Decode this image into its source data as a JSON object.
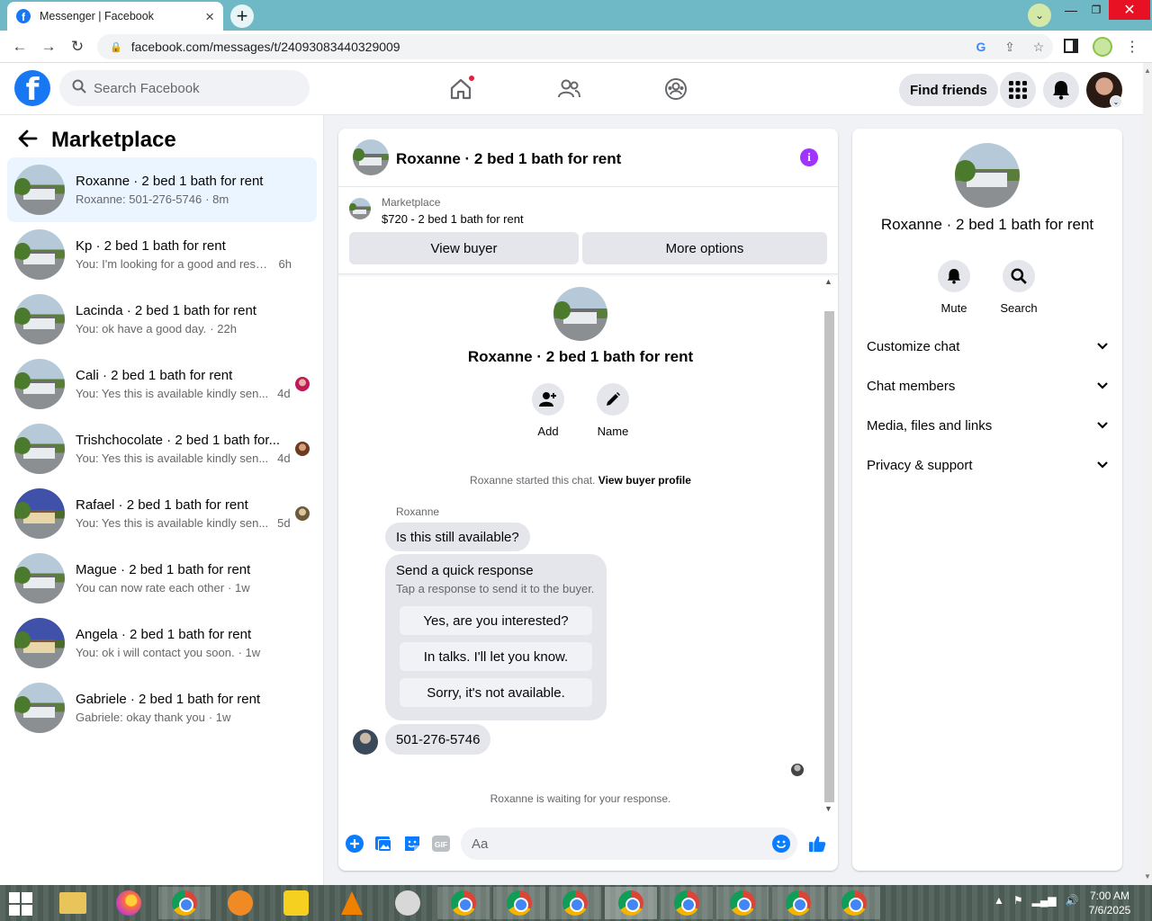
{
  "browser": {
    "tab_title": "Messenger | Facebook",
    "url": "facebook.com/messages/t/24093083440329009"
  },
  "header": {
    "search_placeholder": "Search Facebook",
    "find_friends": "Find friends"
  },
  "sidebar": {
    "title": "Marketplace",
    "conversations": [
      {
        "name": "Roxanne · 2 bed 1 bath for rent",
        "message": "Roxanne: 501-276-5746",
        "time": "· 8m",
        "active": true
      },
      {
        "name": "Kp · 2 bed 1 bath for rent",
        "message": "You: I'm looking for a good and respo...",
        "time": "6h"
      },
      {
        "name": "Lacinda · 2 bed 1 bath for rent",
        "message": "You: ok have a good day.",
        "time": "· 22h"
      },
      {
        "name": "Cali · 2 bed 1 bath for rent",
        "message": "You: Yes this is available kindly sen...",
        "time": "4d"
      },
      {
        "name": "Trishchocolate · 2 bed 1 bath for...",
        "message": "You: Yes this is available kindly sen...",
        "time": "4d"
      },
      {
        "name": "Rafael · 2 bed 1 bath for rent",
        "message": "You: Yes this is available kindly sen...",
        "time": "5d"
      },
      {
        "name": "Mague · 2 bed 1 bath for rent",
        "message": "You can now rate each other",
        "time": "· 1w"
      },
      {
        "name": "Angela · 2 bed 1 bath for rent",
        "message": "You: ok i will contact you soon.",
        "time": "· 1w"
      },
      {
        "name": "Gabriele · 2 bed 1 bath for rent",
        "message": "Gabriele: okay thank you",
        "time": "· 1w"
      }
    ]
  },
  "chat": {
    "title": "Roxanne · 2 bed 1 bath for rent",
    "listing_category": "Marketplace",
    "listing_price": "$720 - 2 bed 1 bath for rent",
    "view_buyer": "View buyer",
    "more_options": "More options",
    "intro_title": "Roxanne · 2 bed 1 bath for rent",
    "add_label": "Add",
    "name_label": "Name",
    "started_text": "Roxanne started this chat.",
    "view_buyer_profile": "View buyer profile",
    "sender": "Roxanne",
    "message1": "Is this still available?",
    "quick_title": "Send a quick response",
    "quick_sub": "Tap a response to send it to the buyer.",
    "quick_replies": [
      "Yes, are you interested?",
      "In talks. I'll let you know.",
      "Sorry, it's not available."
    ],
    "message2": "501-276-5746",
    "waiting": "Roxanne is waiting for your response.",
    "composer_placeholder": "Aa",
    "gif_label": "GIF"
  },
  "details": {
    "title": "Roxanne · 2 bed 1 bath for rent",
    "mute": "Mute",
    "search": "Search",
    "sections": [
      "Customize chat",
      "Chat members",
      "Media, files and links",
      "Privacy & support"
    ]
  },
  "taskbar": {
    "time": "7:00 AM",
    "date": "7/6/2025"
  },
  "colors": {
    "fb_blue": "#1877f2",
    "messenger_purple": "#a033ff",
    "active_conv_bg": "#ebf5ff"
  }
}
